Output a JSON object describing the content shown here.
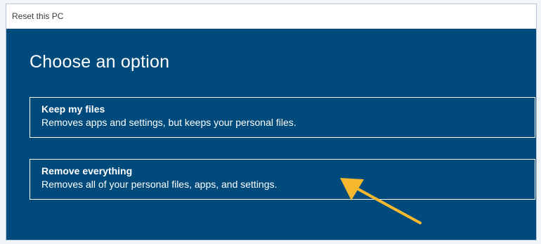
{
  "window": {
    "title": "Reset this PC"
  },
  "main": {
    "heading": "Choose an option",
    "options": [
      {
        "title": "Keep my files",
        "description": "Removes apps and settings, but keeps your personal files."
      },
      {
        "title": "Remove everything",
        "description": "Removes all of your personal files, apps, and settings."
      }
    ]
  },
  "colors": {
    "background": "#004a7c",
    "annotation_arrow": "#f5b82e"
  },
  "annotation": {
    "icon": "annotation-arrow-icon"
  }
}
